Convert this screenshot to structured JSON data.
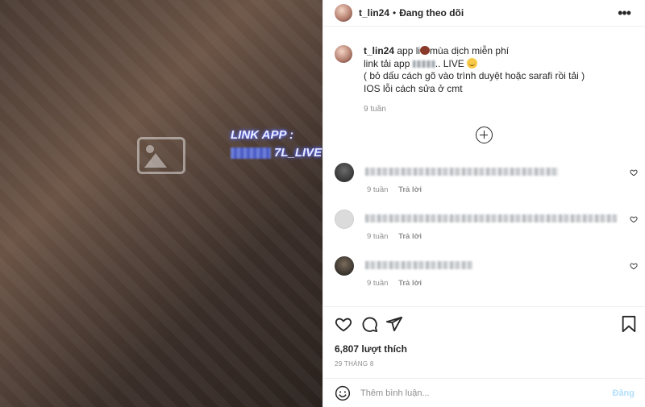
{
  "media": {
    "placeholder_label": "",
    "overlay": {
      "line1": "LINK APP :",
      "line2_suffix": "7L_LIVE"
    }
  },
  "header": {
    "username": "t_lin24",
    "separator": "•",
    "follow_status": "Đang theo dõi",
    "more_icon": "more-options-icon"
  },
  "caption": {
    "username": "t_lin24",
    "line1_a": "app li",
    "line1_b": "mùa dịch miễn phí",
    "line2_a": "link tải app",
    "line2_b": ".. LIVE",
    "line3": "( bỏ dấu cách gõ vào trình duyệt hoặc sarafi rồi tải )",
    "line4": "IOS lỗi cách sửa ở cmt",
    "time": "9 tuần"
  },
  "comments": [
    {
      "time": "9 tuần",
      "reply": "Trả lời",
      "avatar_color": "#2f2f2f"
    },
    {
      "time": "9 tuần",
      "reply": "Trả lời",
      "avatar_color": "#dcdcdc"
    },
    {
      "time": "9 tuần",
      "reply": "Trả lời",
      "avatar_color": "#3a3a3a"
    }
  ],
  "actions": {
    "likes": "6,807 lượt thích",
    "date": "29 THÁNG 8"
  },
  "add_comment": {
    "placeholder": "Thêm bình luận...",
    "post_label": "Đăng"
  },
  "colors": {
    "text": "#262626",
    "muted": "#8e8e8e",
    "border": "#efefef",
    "post_disabled": "#b2dffc"
  }
}
